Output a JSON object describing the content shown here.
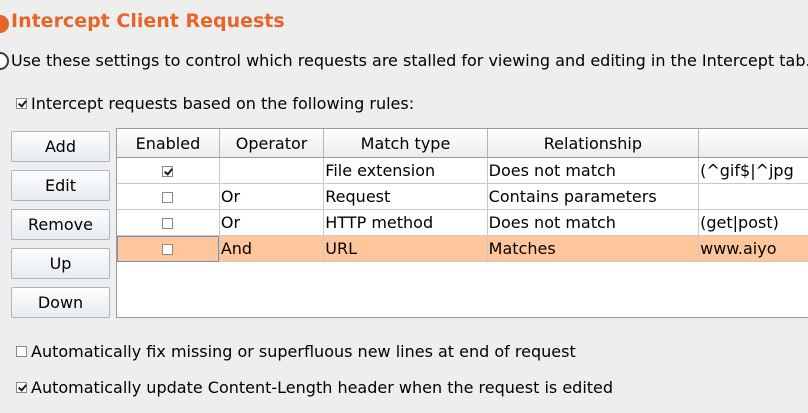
{
  "header": {
    "title": "Intercept Client Requests",
    "description": "Use these settings to control which requests are stalled for viewing and editing in the Intercept tab."
  },
  "intercept_rules_checkbox": {
    "label": "Intercept requests based on the following rules:",
    "checked": true
  },
  "buttons": {
    "add": "Add",
    "edit": "Edit",
    "remove": "Remove",
    "up": "Up",
    "down": "Down"
  },
  "rules_table": {
    "columns": [
      "Enabled",
      "Operator",
      "Match type",
      "Relationship",
      ""
    ],
    "rows": [
      {
        "enabled": true,
        "operator": "",
        "match_type": "File extension",
        "relationship": "Does not match",
        "condition": "(^gif$|^jpg",
        "selected": false
      },
      {
        "enabled": false,
        "operator": "Or",
        "match_type": "Request",
        "relationship": "Contains parameters",
        "condition": "",
        "selected": false
      },
      {
        "enabled": false,
        "operator": "Or",
        "match_type": "HTTP method",
        "relationship": "Does not match",
        "condition": "(get|post)",
        "selected": false
      },
      {
        "enabled": false,
        "operator": "And",
        "match_type": "URL",
        "relationship": "Matches",
        "condition": "www.aiyo",
        "selected": true
      }
    ]
  },
  "options": {
    "fix_newlines": {
      "label": "Automatically fix missing or superfluous new lines at end of request",
      "checked": false
    },
    "update_content_length": {
      "label": "Automatically update Content-Length header when the request is edited",
      "checked": true
    }
  },
  "colors": {
    "accent": "#e8652a",
    "selected_row": "#ffc59b",
    "background": "#eeeeee"
  }
}
